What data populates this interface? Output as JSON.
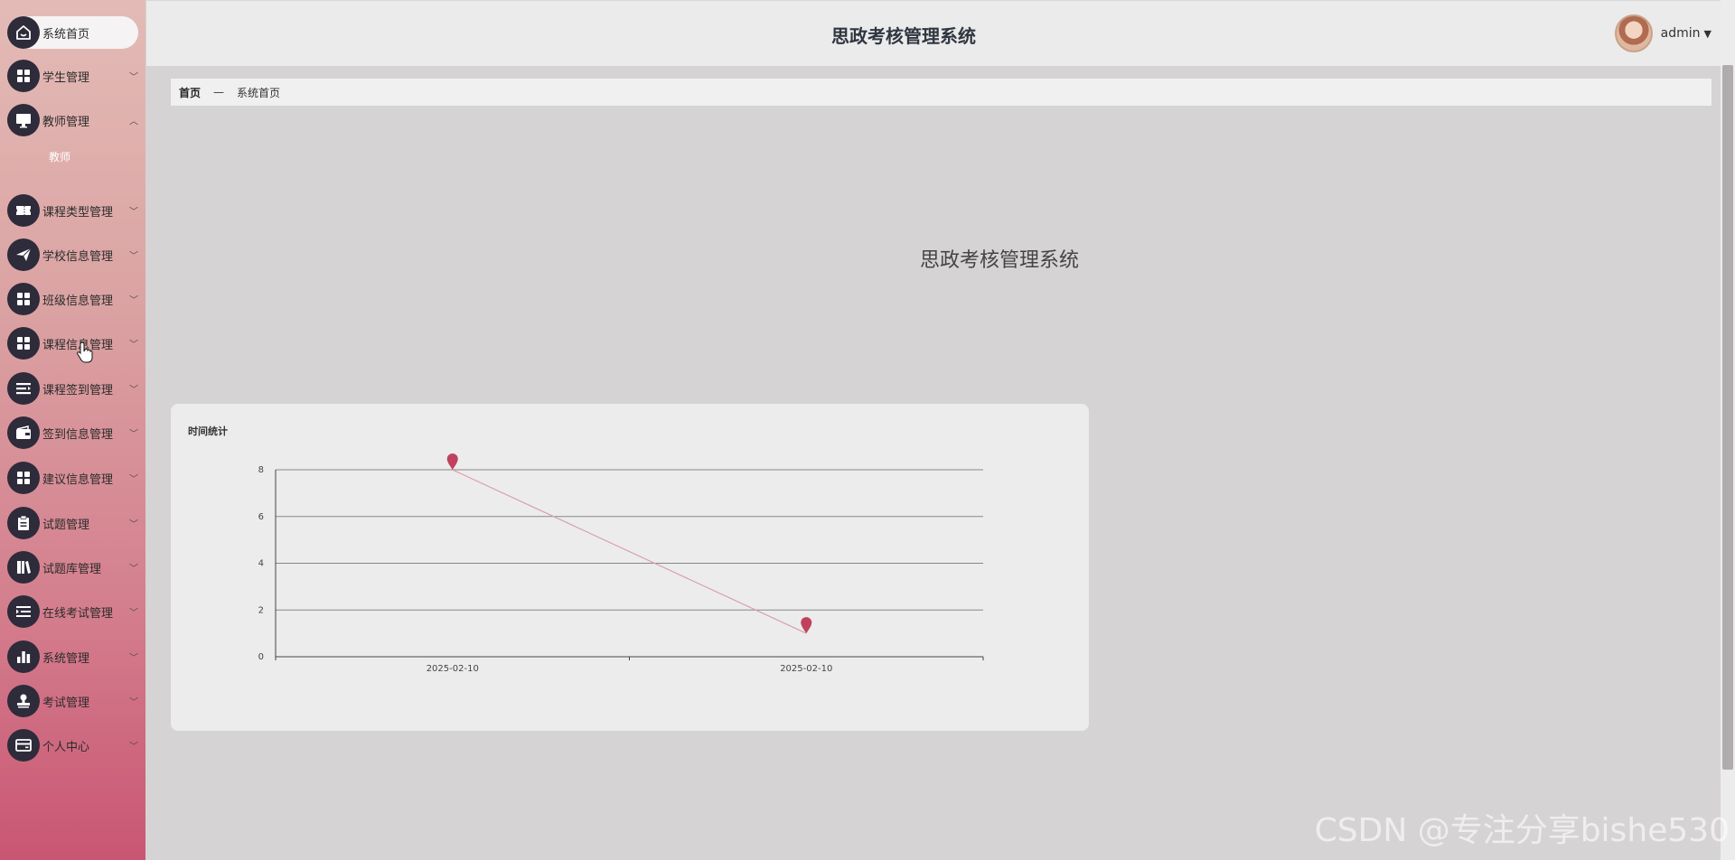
{
  "sidebar": {
    "items": [
      {
        "label": "系统首页",
        "icon": "home-icon",
        "active": true,
        "chevron": ""
      },
      {
        "label": "学生管理",
        "icon": "grid-icon",
        "chevron": "﹀"
      },
      {
        "label": "教师管理",
        "icon": "monitor-icon",
        "chevron": "︿",
        "expanded": true
      },
      {
        "label": "课程类型管理",
        "icon": "ticket-icon",
        "chevron": "﹀"
      },
      {
        "label": "学校信息管理",
        "icon": "send-icon",
        "chevron": "﹀"
      },
      {
        "label": "班级信息管理",
        "icon": "grid-icon",
        "chevron": "﹀"
      },
      {
        "label": "课程信息管理",
        "icon": "grid-icon",
        "chevron": "﹀"
      },
      {
        "label": "课程签到管理",
        "icon": "list-icon",
        "chevron": "﹀"
      },
      {
        "label": "签到信息管理",
        "icon": "wallet-icon",
        "chevron": "﹀"
      },
      {
        "label": "建议信息管理",
        "icon": "grid-icon",
        "chevron": "﹀"
      },
      {
        "label": "试题管理",
        "icon": "clipboard-icon",
        "chevron": "﹀"
      },
      {
        "label": "试题库管理",
        "icon": "book-icon",
        "chevron": "﹀"
      },
      {
        "label": "在线考试管理",
        "icon": "list-indent-icon",
        "chevron": "﹀"
      },
      {
        "label": "系统管理",
        "icon": "bar-chart-icon",
        "chevron": "﹀"
      },
      {
        "label": "考试管理",
        "icon": "stamp-icon",
        "chevron": "﹀"
      },
      {
        "label": "个人中心",
        "icon": "card-icon",
        "chevron": "﹀"
      }
    ],
    "submenu": {
      "label": "教师"
    }
  },
  "header": {
    "title": "思政考核管理系统",
    "username": "admin",
    "caret": "▼"
  },
  "breadcrumb": {
    "home": "首页",
    "separator": "—",
    "current": "系统首页"
  },
  "welcome": {
    "text": "思政考核管理系统"
  },
  "chart_card": {
    "title": "时间统计"
  },
  "chart_data": {
    "type": "line",
    "title": "时间统计",
    "categories": [
      "2025-02-10",
      "2025-02-10"
    ],
    "series": [
      {
        "values": [
          8,
          1
        ]
      }
    ],
    "yticks": [
      0,
      2,
      4,
      6,
      8
    ],
    "ylim": [
      0,
      8
    ],
    "grid": true,
    "colors": {
      "line": "#d9a0ab",
      "marker": "#c0415f"
    }
  },
  "watermark": {
    "text": "CSDN @专注分享bishe530"
  }
}
